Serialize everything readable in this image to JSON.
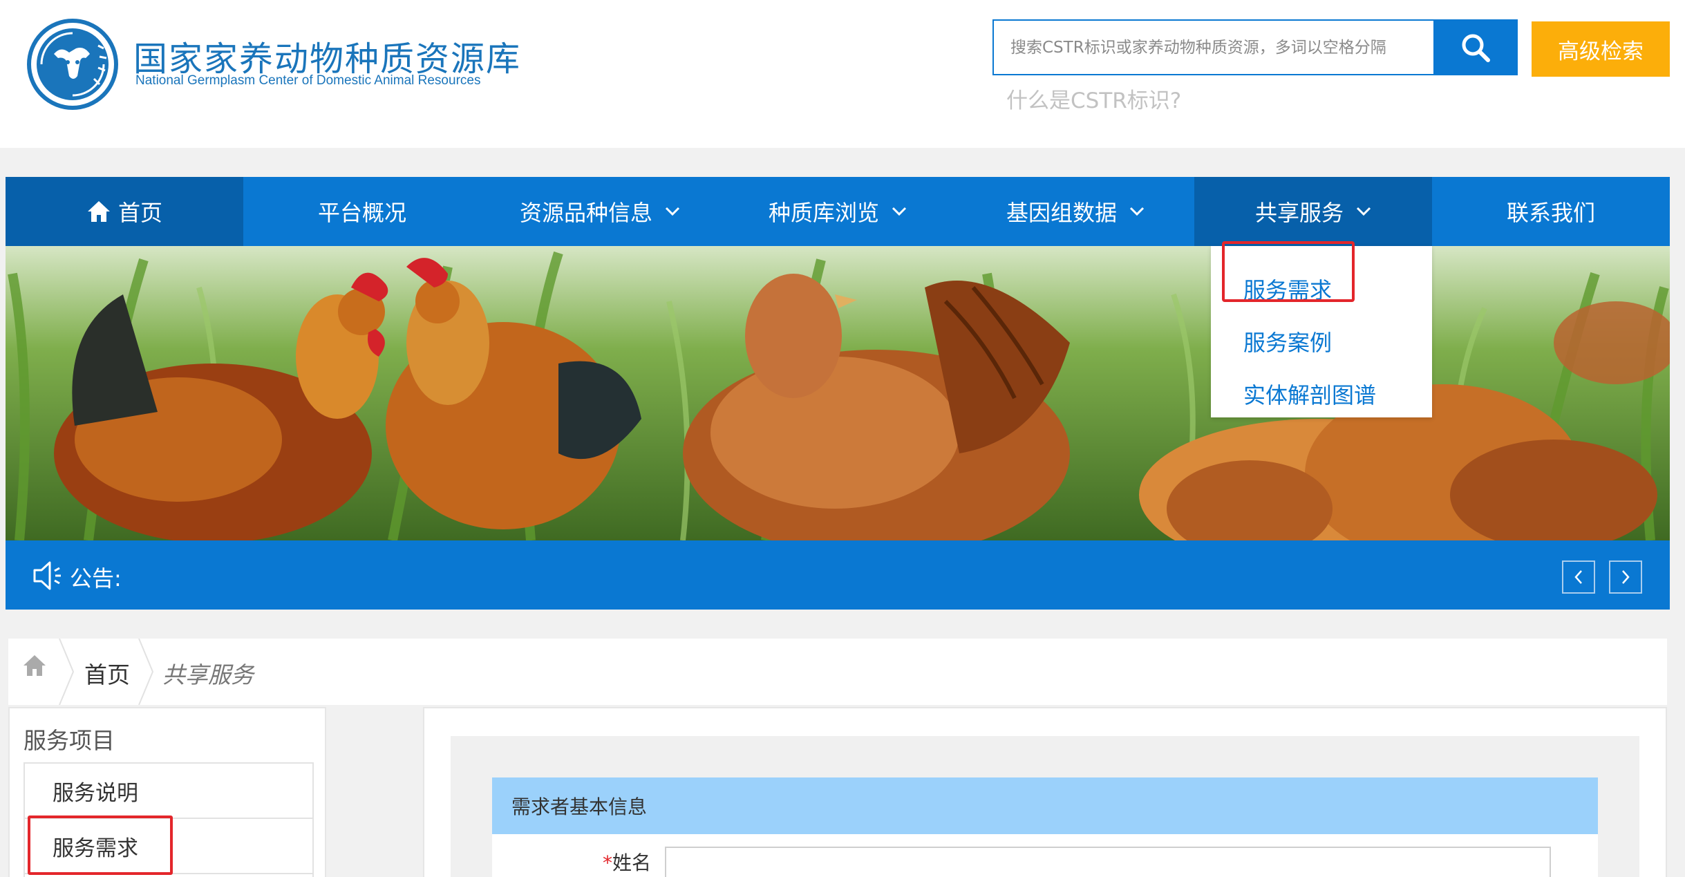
{
  "header": {
    "logo_title_cn": "国家家养动物种质资源库",
    "logo_title_en": "National Germplasm Center of Domestic Animal Resources",
    "search_placeholder": "搜索CSTR标识或家养动物种质资源，多词以空格分隔",
    "search_value": "",
    "advanced_search_label": "高级检索",
    "cstr_help_link": "什么是CSTR标识?"
  },
  "colors": {
    "primary_blue": "#0a78d2",
    "nav_active": "#0760aa",
    "accent_orange": "#fcae0a",
    "highlight_red": "#e3262b",
    "form_header_blue": "#9bd1fb"
  },
  "nav": {
    "items": [
      {
        "label": "首页",
        "icon": "home-icon",
        "has_dropdown": false
      },
      {
        "label": "平台概况",
        "has_dropdown": false
      },
      {
        "label": "资源品种信息",
        "has_dropdown": true
      },
      {
        "label": "种质库浏览",
        "has_dropdown": true
      },
      {
        "label": "基因组数据",
        "has_dropdown": true
      },
      {
        "label": "共享服务",
        "has_dropdown": true
      },
      {
        "label": "联系我们",
        "has_dropdown": false
      }
    ]
  },
  "dropdown": {
    "items": [
      "服务需求",
      "服务案例",
      "实体解剖图谱"
    ]
  },
  "notice": {
    "label": "公告:"
  },
  "breadcrumb": {
    "home_link": "首页",
    "current": "共享服务"
  },
  "sidebar": {
    "title": "服务项目",
    "items": [
      "服务说明",
      "服务需求"
    ]
  },
  "form": {
    "section_title": "需求者基本信息",
    "fields": [
      {
        "required_mark": "*",
        "label": "姓名",
        "value": ""
      }
    ]
  }
}
